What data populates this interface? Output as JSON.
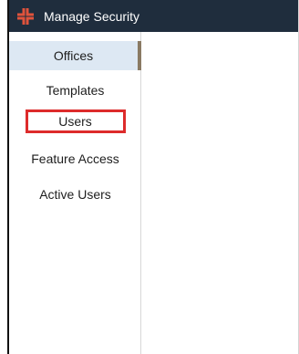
{
  "header": {
    "title": "Manage Security",
    "logo_icon": "brand-logo-icon",
    "logo_color": "#e0533c",
    "bar_color": "#1f2d3d"
  },
  "sidebar": {
    "items": [
      {
        "label": "Offices",
        "active": true,
        "highlighted": false
      },
      {
        "label": "Templates",
        "active": false,
        "highlighted": false
      },
      {
        "label": "Users",
        "active": false,
        "highlighted": true
      },
      {
        "label": "Feature Access",
        "active": false,
        "highlighted": false
      },
      {
        "label": "Active Users",
        "active": false,
        "highlighted": false
      }
    ],
    "active_bg": "#dde8f3",
    "highlight_color": "#dd2b2b"
  }
}
